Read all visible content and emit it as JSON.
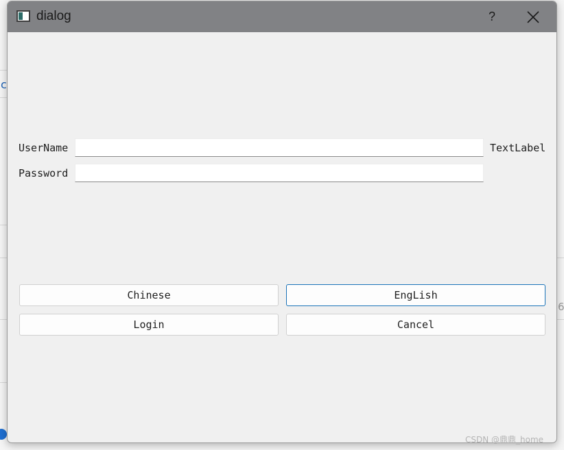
{
  "window": {
    "title": "dialog",
    "help_label": "?",
    "close_icon": "close-icon",
    "app_icon": "window-app-icon"
  },
  "form": {
    "username_label": "UserName",
    "username_value": "",
    "password_label": "Password",
    "password_value": "",
    "status_label": "TextLabel"
  },
  "buttons": {
    "chinese": "Chinese",
    "english": "EngLish",
    "login": "Login",
    "cancel": "Cancel"
  },
  "background": {
    "left_fragment": "c",
    "right_fragment": "6"
  },
  "watermark": "CSDN @鼎鼎_home",
  "colors": {
    "titlebar": "#818285",
    "dialog_bg": "#f0f0f0",
    "focus_border": "#1a73b8"
  }
}
